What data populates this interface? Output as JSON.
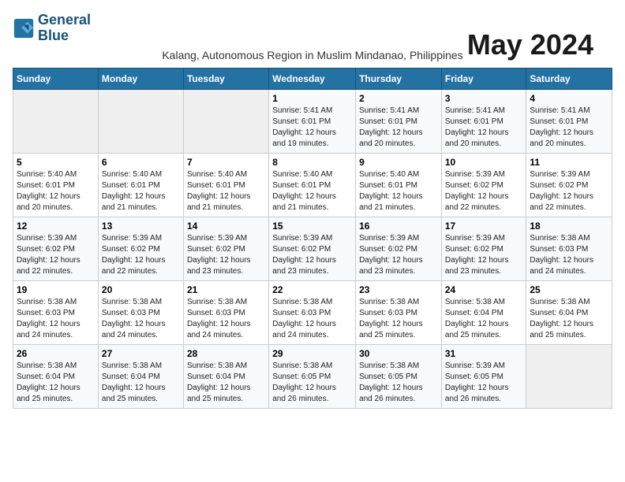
{
  "logo": {
    "line1": "General",
    "line2": "Blue"
  },
  "title": "May 2024",
  "subtitle": "Kalang, Autonomous Region in Muslim Mindanao, Philippines",
  "headers": [
    "Sunday",
    "Monday",
    "Tuesday",
    "Wednesday",
    "Thursday",
    "Friday",
    "Saturday"
  ],
  "weeks": [
    [
      {
        "day": "",
        "info": ""
      },
      {
        "day": "",
        "info": ""
      },
      {
        "day": "",
        "info": ""
      },
      {
        "day": "1",
        "info": "Sunrise: 5:41 AM\nSunset: 6:01 PM\nDaylight: 12 hours\nand 19 minutes."
      },
      {
        "day": "2",
        "info": "Sunrise: 5:41 AM\nSunset: 6:01 PM\nDaylight: 12 hours\nand 20 minutes."
      },
      {
        "day": "3",
        "info": "Sunrise: 5:41 AM\nSunset: 6:01 PM\nDaylight: 12 hours\nand 20 minutes."
      },
      {
        "day": "4",
        "info": "Sunrise: 5:41 AM\nSunset: 6:01 PM\nDaylight: 12 hours\nand 20 minutes."
      }
    ],
    [
      {
        "day": "5",
        "info": "Sunrise: 5:40 AM\nSunset: 6:01 PM\nDaylight: 12 hours\nand 20 minutes."
      },
      {
        "day": "6",
        "info": "Sunrise: 5:40 AM\nSunset: 6:01 PM\nDaylight: 12 hours\nand 21 minutes."
      },
      {
        "day": "7",
        "info": "Sunrise: 5:40 AM\nSunset: 6:01 PM\nDaylight: 12 hours\nand 21 minutes."
      },
      {
        "day": "8",
        "info": "Sunrise: 5:40 AM\nSunset: 6:01 PM\nDaylight: 12 hours\nand 21 minutes."
      },
      {
        "day": "9",
        "info": "Sunrise: 5:40 AM\nSunset: 6:01 PM\nDaylight: 12 hours\nand 21 minutes."
      },
      {
        "day": "10",
        "info": "Sunrise: 5:39 AM\nSunset: 6:02 PM\nDaylight: 12 hours\nand 22 minutes."
      },
      {
        "day": "11",
        "info": "Sunrise: 5:39 AM\nSunset: 6:02 PM\nDaylight: 12 hours\nand 22 minutes."
      }
    ],
    [
      {
        "day": "12",
        "info": "Sunrise: 5:39 AM\nSunset: 6:02 PM\nDaylight: 12 hours\nand 22 minutes."
      },
      {
        "day": "13",
        "info": "Sunrise: 5:39 AM\nSunset: 6:02 PM\nDaylight: 12 hours\nand 22 minutes."
      },
      {
        "day": "14",
        "info": "Sunrise: 5:39 AM\nSunset: 6:02 PM\nDaylight: 12 hours\nand 23 minutes."
      },
      {
        "day": "15",
        "info": "Sunrise: 5:39 AM\nSunset: 6:02 PM\nDaylight: 12 hours\nand 23 minutes."
      },
      {
        "day": "16",
        "info": "Sunrise: 5:39 AM\nSunset: 6:02 PM\nDaylight: 12 hours\nand 23 minutes."
      },
      {
        "day": "17",
        "info": "Sunrise: 5:39 AM\nSunset: 6:02 PM\nDaylight: 12 hours\nand 23 minutes."
      },
      {
        "day": "18",
        "info": "Sunrise: 5:38 AM\nSunset: 6:03 PM\nDaylight: 12 hours\nand 24 minutes."
      }
    ],
    [
      {
        "day": "19",
        "info": "Sunrise: 5:38 AM\nSunset: 6:03 PM\nDaylight: 12 hours\nand 24 minutes."
      },
      {
        "day": "20",
        "info": "Sunrise: 5:38 AM\nSunset: 6:03 PM\nDaylight: 12 hours\nand 24 minutes."
      },
      {
        "day": "21",
        "info": "Sunrise: 5:38 AM\nSunset: 6:03 PM\nDaylight: 12 hours\nand 24 minutes."
      },
      {
        "day": "22",
        "info": "Sunrise: 5:38 AM\nSunset: 6:03 PM\nDaylight: 12 hours\nand 24 minutes."
      },
      {
        "day": "23",
        "info": "Sunrise: 5:38 AM\nSunset: 6:03 PM\nDaylight: 12 hours\nand 25 minutes."
      },
      {
        "day": "24",
        "info": "Sunrise: 5:38 AM\nSunset: 6:04 PM\nDaylight: 12 hours\nand 25 minutes."
      },
      {
        "day": "25",
        "info": "Sunrise: 5:38 AM\nSunset: 6:04 PM\nDaylight: 12 hours\nand 25 minutes."
      }
    ],
    [
      {
        "day": "26",
        "info": "Sunrise: 5:38 AM\nSunset: 6:04 PM\nDaylight: 12 hours\nand 25 minutes."
      },
      {
        "day": "27",
        "info": "Sunrise: 5:38 AM\nSunset: 6:04 PM\nDaylight: 12 hours\nand 25 minutes."
      },
      {
        "day": "28",
        "info": "Sunrise: 5:38 AM\nSunset: 6:04 PM\nDaylight: 12 hours\nand 25 minutes."
      },
      {
        "day": "29",
        "info": "Sunrise: 5:38 AM\nSunset: 6:05 PM\nDaylight: 12 hours\nand 26 minutes."
      },
      {
        "day": "30",
        "info": "Sunrise: 5:38 AM\nSunset: 6:05 PM\nDaylight: 12 hours\nand 26 minutes."
      },
      {
        "day": "31",
        "info": "Sunrise: 5:39 AM\nSunset: 6:05 PM\nDaylight: 12 hours\nand 26 minutes."
      },
      {
        "day": "",
        "info": ""
      }
    ]
  ]
}
